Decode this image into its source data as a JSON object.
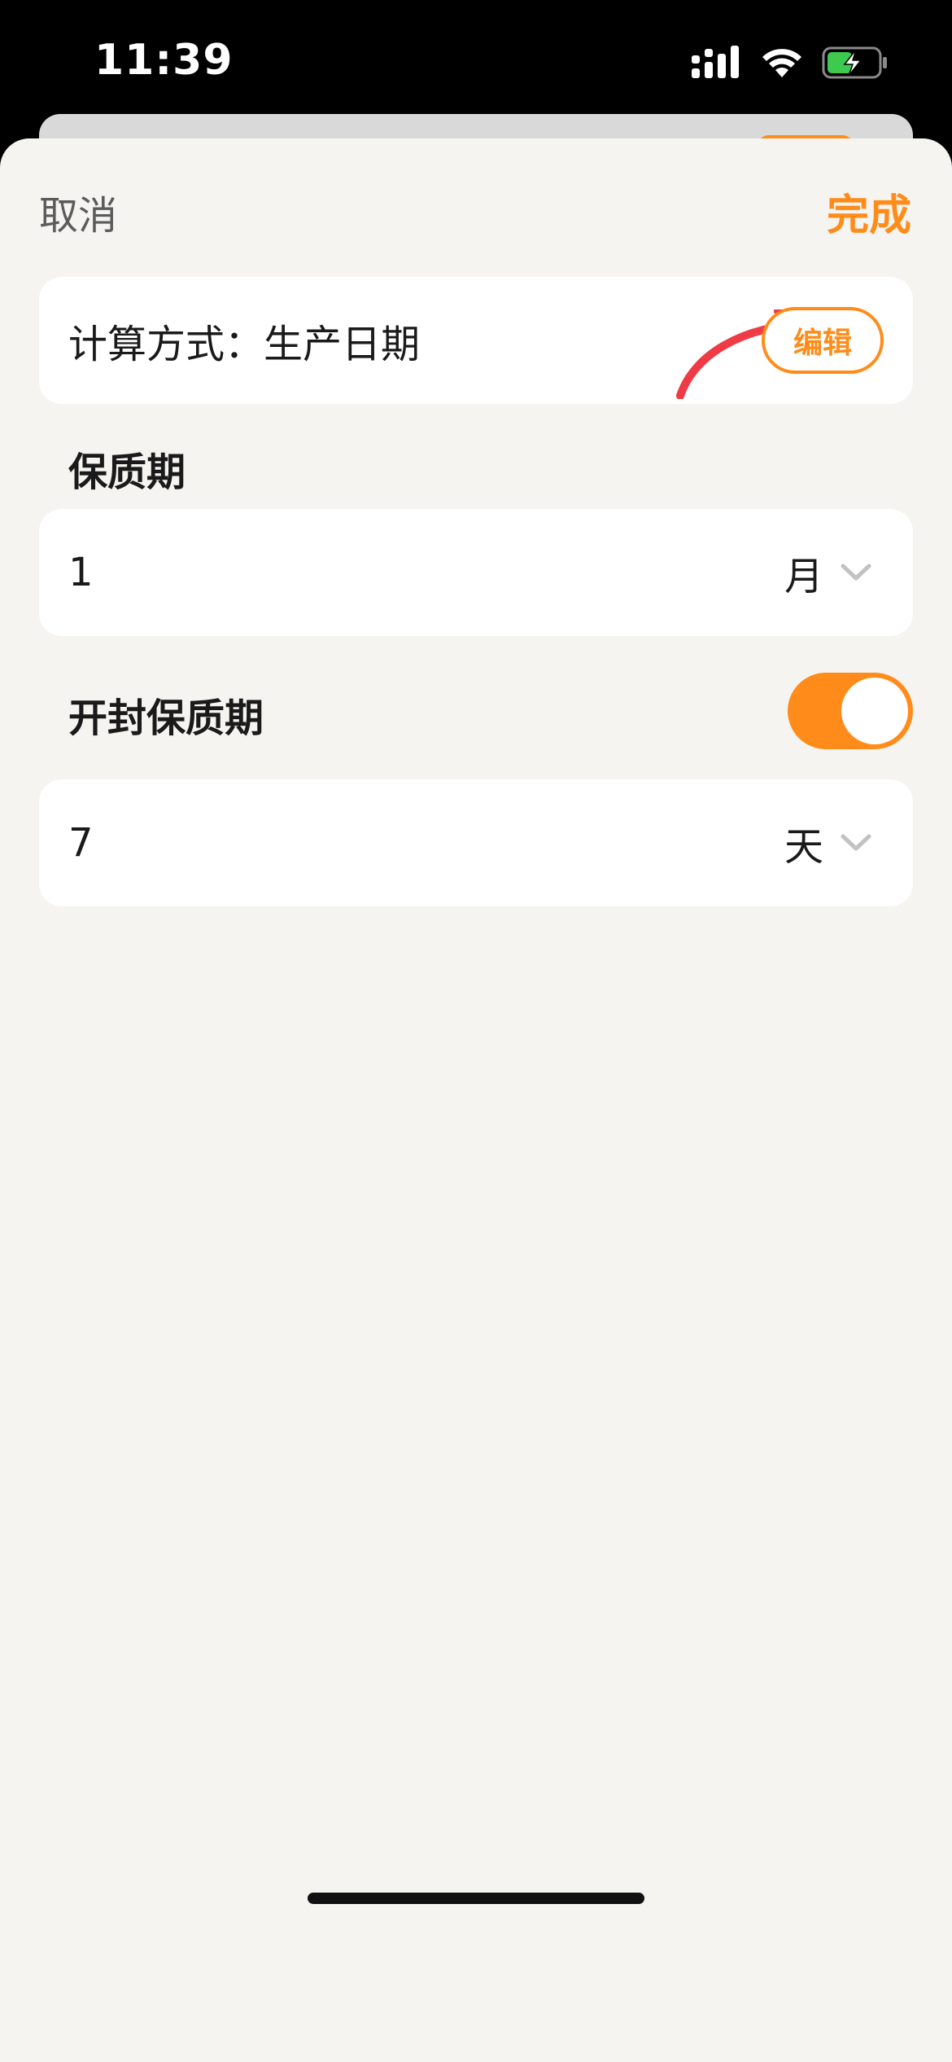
{
  "status_bar": {
    "time": "11:39",
    "icons": [
      "signal-icon",
      "wifi-icon",
      "battery-charging-icon"
    ]
  },
  "nav": {
    "cancel_label": "取消",
    "done_label": "完成"
  },
  "calc_method": {
    "text": "计算方式：生产日期",
    "edit_label": "编辑"
  },
  "shelf_life": {
    "label": "保质期",
    "value": "1",
    "unit": "月"
  },
  "opened_shelf_life": {
    "label": "开封保质期",
    "toggle_on": true,
    "value": "7",
    "unit": "天"
  },
  "colors": {
    "accent": "#ff8c1a",
    "annotation_arrow": "#ee3b45",
    "background": "#f5f4f1"
  }
}
